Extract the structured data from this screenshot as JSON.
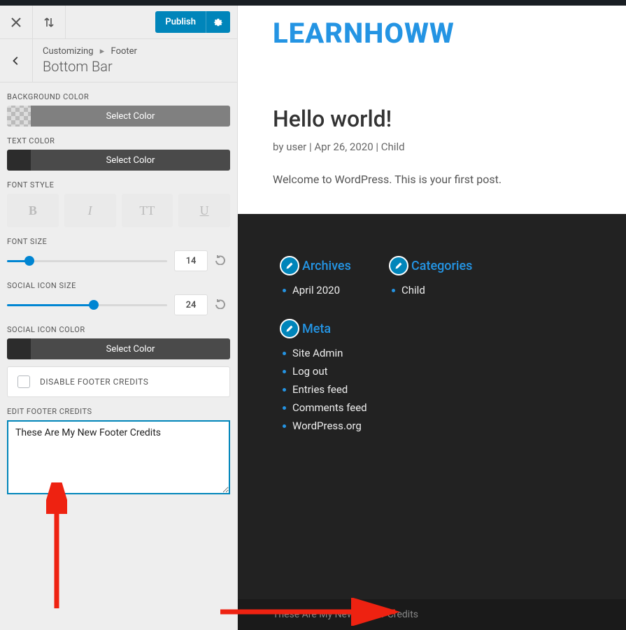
{
  "topbar": {
    "publish_label": "Publish"
  },
  "breadcrumb": {
    "root": "Customizing",
    "parent": "Footer",
    "title": "Bottom Bar"
  },
  "controls": {
    "bg_color_label": "BACKGROUND COLOR",
    "text_color_label": "TEXT COLOR",
    "select_color": "Select Color",
    "font_style_label": "FONT STYLE",
    "fs_b": "B",
    "fs_i": "I",
    "fs_tt": "TT",
    "fs_u": "U",
    "font_size_label": "FONT SIZE",
    "font_size_value": "14",
    "font_size_fill_pct": 14,
    "social_icon_size_label": "SOCIAL ICON SIZE",
    "social_icon_size_value": "24",
    "social_icon_size_fill_pct": 54,
    "social_icon_color_label": "SOCIAL ICON COLOR",
    "disable_credits_label": "DISABLE FOOTER CREDITS",
    "edit_credits_label": "EDIT FOOTER CREDITS",
    "edit_credits_value": "These Are My New Footer Credits"
  },
  "preview": {
    "brand": "LEARNHOWW",
    "post_title": "Hello world!",
    "meta_by": "by",
    "meta_author": "user",
    "meta_date": "Apr 26, 2020",
    "meta_cat": "Child",
    "excerpt": "Welcome to WordPress. This is your first post. ",
    "widgets": {
      "archives_title": "Archives",
      "archives_item": "April 2020",
      "categories_title": "Categories",
      "categories_item": "Child",
      "meta_title": "Meta",
      "meta_items": [
        "Site Admin",
        "Log out",
        "Entries feed",
        "Comments feed",
        "WordPress.org"
      ]
    },
    "bottom_bar_text": "These Are My New Footer Credits"
  }
}
